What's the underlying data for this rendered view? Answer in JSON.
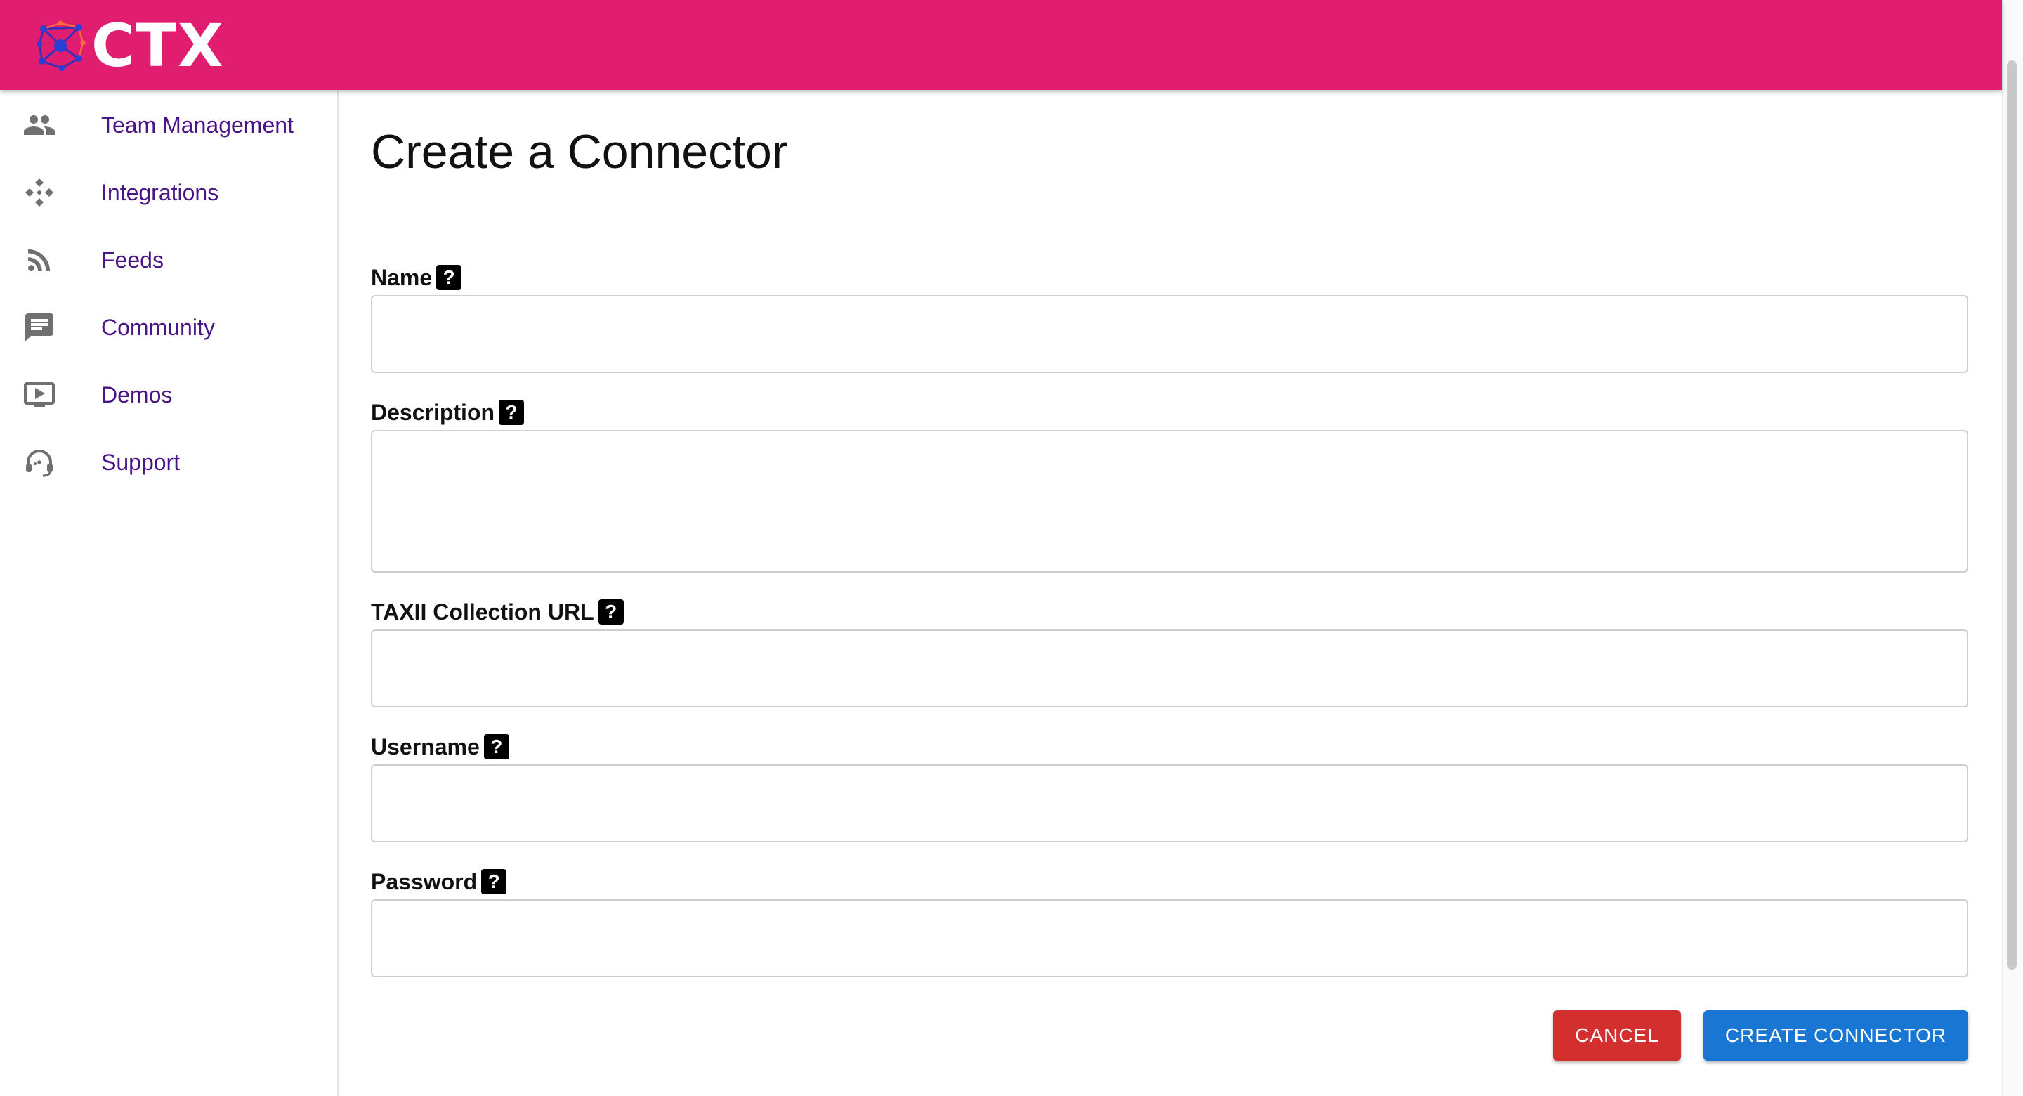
{
  "header": {
    "logo_text": "CTX",
    "logo_icon": "network-molecule-icon",
    "background_color": "#e11d6f"
  },
  "sidebar": {
    "items": [
      {
        "label": "Team Management",
        "icon": "people-icon"
      },
      {
        "label": "Integrations",
        "icon": "integrations-icon"
      },
      {
        "label": "Feeds",
        "icon": "rss-feed-icon"
      },
      {
        "label": "Community",
        "icon": "chat-bubble-icon"
      },
      {
        "label": "Demos",
        "icon": "video-play-icon"
      },
      {
        "label": "Support",
        "icon": "headset-icon"
      }
    ],
    "label_color": "#4a1486"
  },
  "main": {
    "title": "Create a Connector",
    "fields": {
      "name": {
        "label": "Name",
        "value": "",
        "help": "?"
      },
      "description": {
        "label": "Description",
        "value": "",
        "help": "?"
      },
      "taxii_url": {
        "label": "TAXII Collection URL",
        "value": "",
        "help": "?"
      },
      "username": {
        "label": "Username",
        "value": "",
        "help": "?"
      },
      "password": {
        "label": "Password",
        "value": "",
        "help": "?"
      }
    },
    "buttons": {
      "cancel": {
        "label": "CANCEL",
        "color": "#d32f2f"
      },
      "create": {
        "label": "CREATE CONNECTOR",
        "color": "#1976d2"
      }
    }
  }
}
